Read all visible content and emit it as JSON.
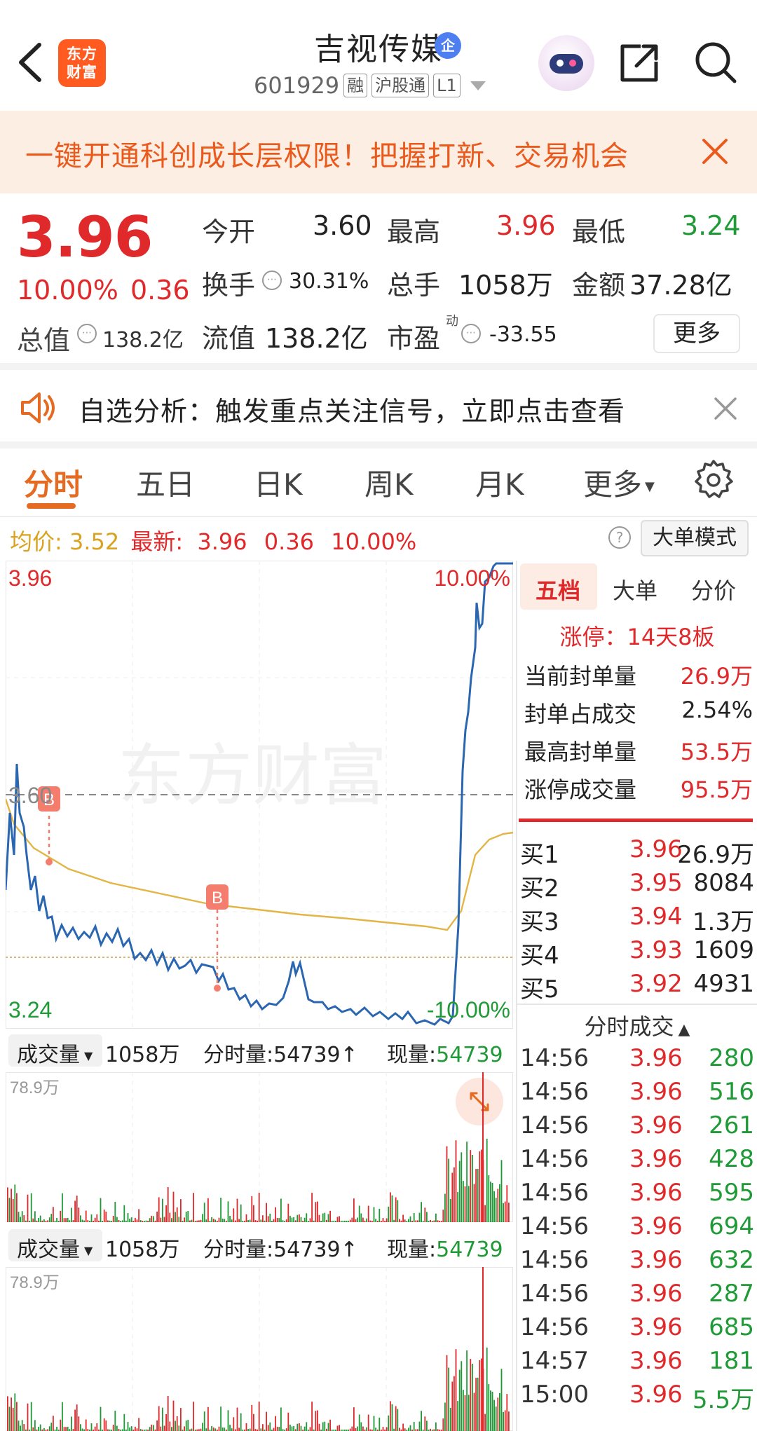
{
  "header": {
    "logo_text_1": "东方",
    "logo_text_2": "财富",
    "stock_name": "吉视传媒",
    "enterprise_badge": "企",
    "stock_code": "601929",
    "tags": [
      "融",
      "沪股通",
      "L1"
    ]
  },
  "promo": {
    "text": "一键开通科创成长层权限！把握打新、交易机会"
  },
  "quote": {
    "price": "3.96",
    "change_pct": "10.00%",
    "change": "0.36",
    "total_value_label": "总值",
    "total_value": "138.2亿",
    "open_label": "今开",
    "open": "3.60",
    "high_label": "最高",
    "high": "3.96",
    "low_label": "最低",
    "low": "3.24",
    "turnover_label": "换手",
    "turnover": "30.31%",
    "volume_label": "总手",
    "volume": "1058万",
    "amount_label": "金额",
    "amount": "37.28亿",
    "float_value_label": "流值",
    "float_value": "138.2亿",
    "pe_label": "市盈",
    "pe_sup": "动",
    "pe": "-33.55",
    "more_button": "更多"
  },
  "notice": {
    "text": "自选分析：触发重点关注信号，立即点击查看"
  },
  "tabs": [
    "分时",
    "五日",
    "日K",
    "周K",
    "月K",
    "更多"
  ],
  "avg_bar": {
    "avg_label": "均价:",
    "avg_value": "3.52",
    "latest_label": "最新:",
    "latest_value": "3.96",
    "latest_change": "0.36",
    "latest_pct": "10.00%",
    "help": "?",
    "big_order_mode": "大单模式"
  },
  "chart_labels": {
    "y_top": "3.96",
    "y_mid": "3.60",
    "y_bottom": "3.24",
    "pct_top": "10.00%",
    "pct_bottom": "-10.00%",
    "watermark": "东方财富",
    "marker": "B"
  },
  "volume_panel": {
    "selector": "成交量",
    "total": "1058万",
    "minute_vol_label": "分时量:",
    "minute_vol": "54739↑",
    "current_label": "现量:",
    "current": "54739",
    "max_label": "78.9万"
  },
  "right_panel": {
    "tabs": [
      "五档",
      "大单",
      "分价"
    ],
    "limit_up": "涨停：14天8板",
    "stats": [
      {
        "label": "当前封单量",
        "value": "26.9万",
        "color": "red"
      },
      {
        "label": "封单占成交",
        "value": "2.54%",
        "color": "black"
      },
      {
        "label": "最高封单量",
        "value": "53.5万",
        "color": "red"
      },
      {
        "label": "涨停成交量",
        "value": "95.5万",
        "color": "red"
      }
    ],
    "order_book": [
      {
        "level": "买1",
        "price": "3.96",
        "vol": "26.9万"
      },
      {
        "level": "买2",
        "price": "3.95",
        "vol": "8084"
      },
      {
        "level": "买3",
        "price": "3.94",
        "vol": "1.3万"
      },
      {
        "level": "买4",
        "price": "3.93",
        "vol": "1609"
      },
      {
        "level": "买5",
        "price": "3.92",
        "vol": "4931"
      }
    ],
    "ticks_title": "分时成交",
    "ticks": [
      {
        "time": "14:56",
        "price": "3.96",
        "vol": "280"
      },
      {
        "time": "14:56",
        "price": "3.96",
        "vol": "516"
      },
      {
        "time": "14:56",
        "price": "3.96",
        "vol": "261"
      },
      {
        "time": "14:56",
        "price": "3.96",
        "vol": "428"
      },
      {
        "time": "14:56",
        "price": "3.96",
        "vol": "595"
      },
      {
        "time": "14:56",
        "price": "3.96",
        "vol": "694"
      },
      {
        "time": "14:56",
        "price": "3.96",
        "vol": "632"
      },
      {
        "time": "14:56",
        "price": "3.96",
        "vol": "287"
      },
      {
        "time": "14:56",
        "price": "3.96",
        "vol": "685"
      },
      {
        "time": "14:57",
        "price": "3.96",
        "vol": "181"
      },
      {
        "time": "15:00",
        "price": "3.96",
        "vol": "5.5万"
      }
    ]
  },
  "colors": {
    "up": "#e0292b",
    "down": "#1f9a37",
    "accent": "#e56b23",
    "price_line": "#2b66b0",
    "avg_line": "#e2b544"
  }
}
